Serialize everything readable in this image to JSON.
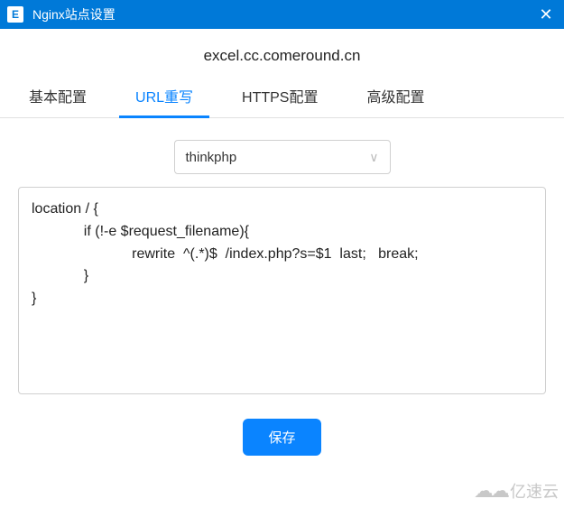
{
  "titlebar": {
    "icon_letter": "E",
    "title": "Nginx站点设置",
    "close_glyph": "✕"
  },
  "domain": "excel.cc.comeround.cn",
  "tabs": [
    {
      "label": "基本配置",
      "active": false
    },
    {
      "label": "URL重写",
      "active": true
    },
    {
      "label": "HTTPS配置",
      "active": false
    },
    {
      "label": "高级配置",
      "active": false
    }
  ],
  "select": {
    "value": "thinkphp",
    "chevron": "∨"
  },
  "code": "location / {\n             if (!-e $request_filename){\n                         rewrite  ^(.*)$  /index.php?s=$1  last;   break;\n             }\n}",
  "buttons": {
    "save": "保存"
  },
  "watermark": {
    "icon": "☁☁",
    "text": "亿速云"
  }
}
